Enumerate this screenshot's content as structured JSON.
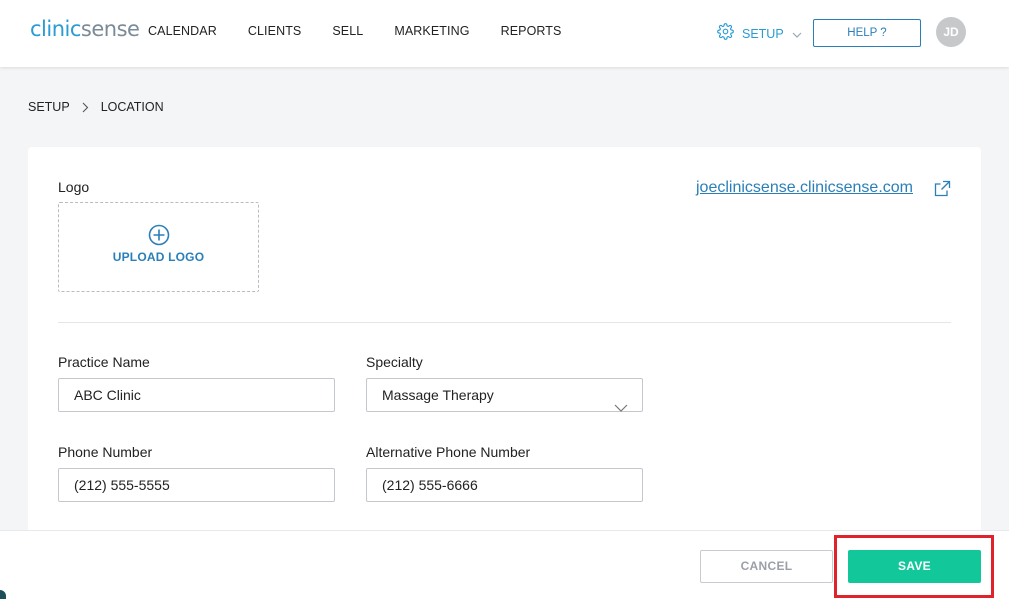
{
  "brand": {
    "part1": "clinic",
    "part2": "sense"
  },
  "nav": {
    "items": [
      "CALENDAR",
      "CLIENTS",
      "SELL",
      "MARKETING",
      "REPORTS"
    ],
    "setup_label": "SETUP",
    "help_label": "HELP ?",
    "avatar_initials": "JD"
  },
  "breadcrumb": {
    "root": "SETUP",
    "current": "LOCATION"
  },
  "location": {
    "logo_label": "Logo",
    "upload_label": "UPLOAD LOGO",
    "site_url": "joeclinicsense.clinicsense.com",
    "practice_name_label": "Practice Name",
    "practice_name_value": "ABC Clinic",
    "specialty_label": "Specialty",
    "specialty_value": "Massage Therapy",
    "phone_label": "Phone Number",
    "phone_value": "(212) 555-5555",
    "alt_phone_label": "Alternative Phone Number",
    "alt_phone_value": "(212) 555-6666"
  },
  "footer": {
    "cancel_label": "CANCEL",
    "save_label": "SAVE"
  },
  "colors": {
    "accent_blue": "#2a7fb8",
    "save_green": "#12c79a",
    "highlight_red": "#e0232a"
  },
  "icons": [
    "gear-icon",
    "chevron-down-icon",
    "chevron-right-icon",
    "plus-circle-icon",
    "external-link-icon"
  ]
}
